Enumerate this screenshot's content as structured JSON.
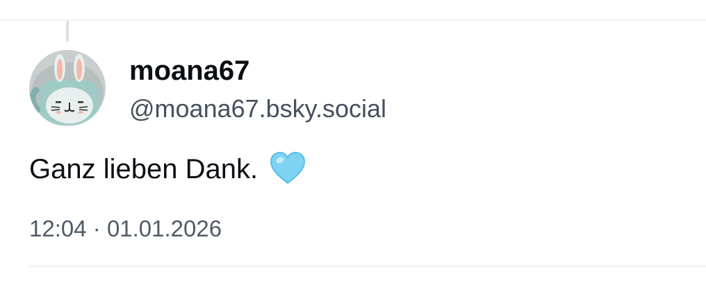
{
  "post": {
    "author": {
      "display_name": "moana67",
      "handle": "@moana67.bsky.social",
      "avatar_icon": "bunny-mug-avatar"
    },
    "text": "Ganz lieben Dank.",
    "emoji_icon": "light-blue-heart-icon",
    "emoji_color": "#7fd3f2",
    "time": "12:04",
    "separator": "·",
    "date": "01.01.2026"
  }
}
